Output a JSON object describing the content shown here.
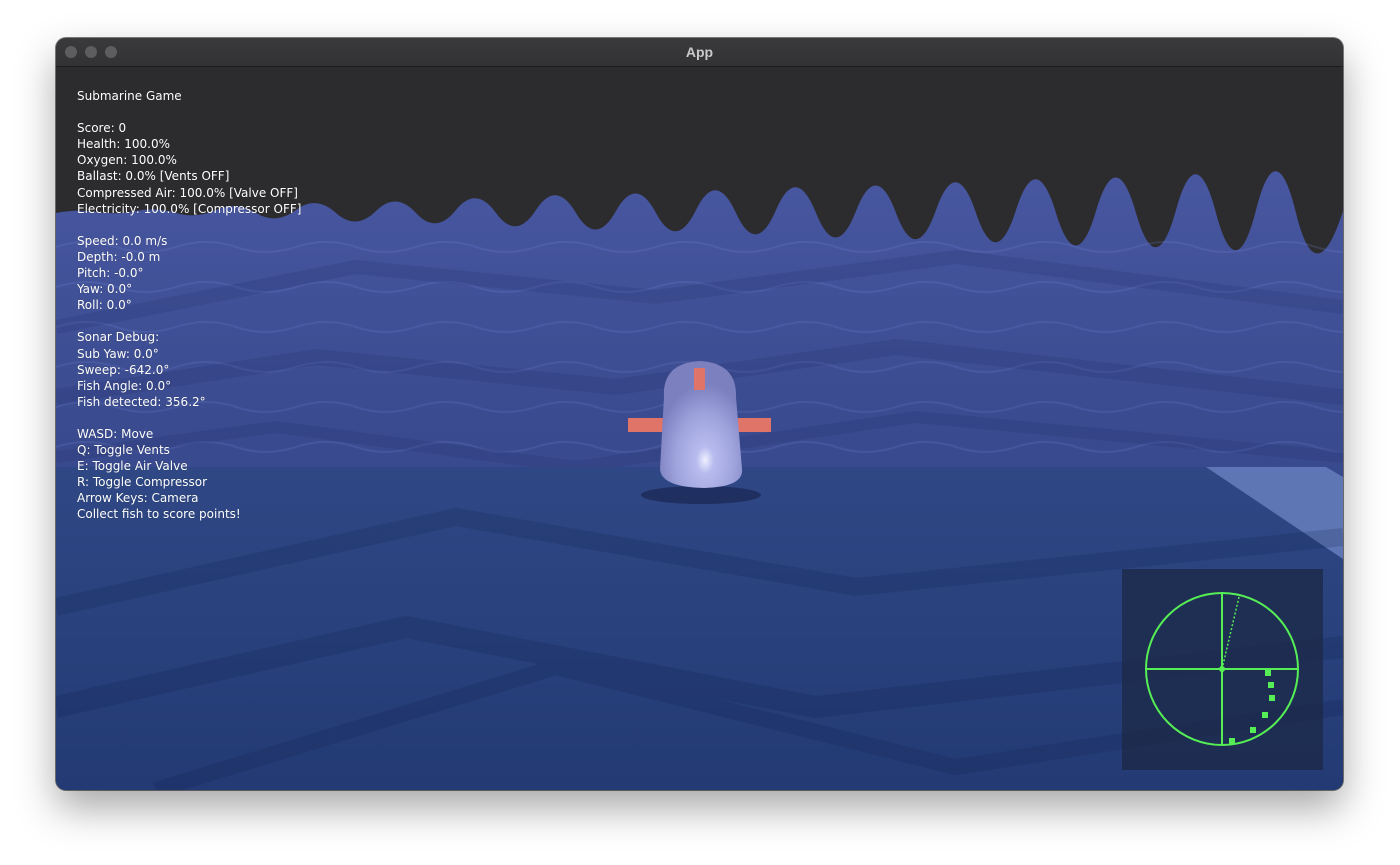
{
  "window": {
    "title": "App"
  },
  "hud": {
    "title": "Submarine Game",
    "status": {
      "score": "Score: 0",
      "health": "Health: 100.0%",
      "oxygen": "Oxygen: 100.0%",
      "ballast": "Ballast: 0.0% [Vents OFF]",
      "compressed_air": "Compressed Air: 100.0% [Valve OFF]",
      "electricity": "Electricity: 100.0% [Compressor OFF]"
    },
    "motion": {
      "speed": "Speed: 0.0 m/s",
      "depth": "Depth: -0.0 m",
      "pitch": "Pitch: -0.0°",
      "yaw": "Yaw: 0.0°",
      "roll": "Roll: 0.0°"
    },
    "sonar_debug": {
      "header": "Sonar Debug:",
      "sub_yaw": "Sub Yaw: 0.0°",
      "sweep": "Sweep: -642.0°",
      "fish_angle": "Fish Angle: 0.0°",
      "fish_detected": "Fish detected: 356.2°"
    },
    "controls": {
      "move": "WASD: Move",
      "vents": "Q: Toggle Vents",
      "air_valve": "E: Toggle Air Valve",
      "compressor": "R: Toggle Compressor",
      "camera": "Arrow Keys: Camera",
      "goal": "Collect fish to score points!"
    }
  },
  "colors": {
    "water_surface": "#4a5a9e",
    "sea_floor": "#2d4683",
    "submarine_hull": "#9fa3dd",
    "submarine_fins": "#e07468",
    "radar_line": "#55ee55",
    "radar_bg": "#1c2846"
  },
  "radar": {
    "sweep_angle_deg": -642.0,
    "contacts_count": 6
  }
}
